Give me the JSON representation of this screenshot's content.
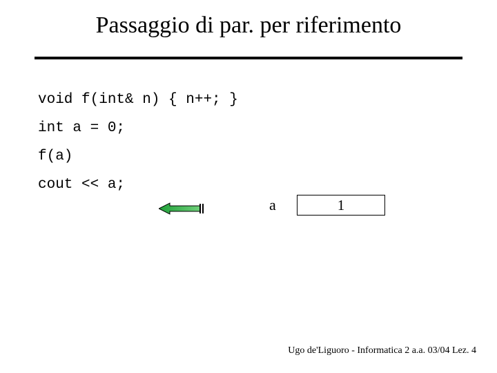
{
  "title": "Passaggio di par. per riferimento",
  "code": {
    "l1": "void f(int& n) { n++; }",
    "l2": "int a = 0;",
    "l3": "f(a)",
    "l4": "cout << a;"
  },
  "diagram": {
    "var_label": "a",
    "box_value": "1"
  },
  "footer": "Ugo de'Liguoro - Informatica 2 a.a. 03/04 Lez. 4"
}
